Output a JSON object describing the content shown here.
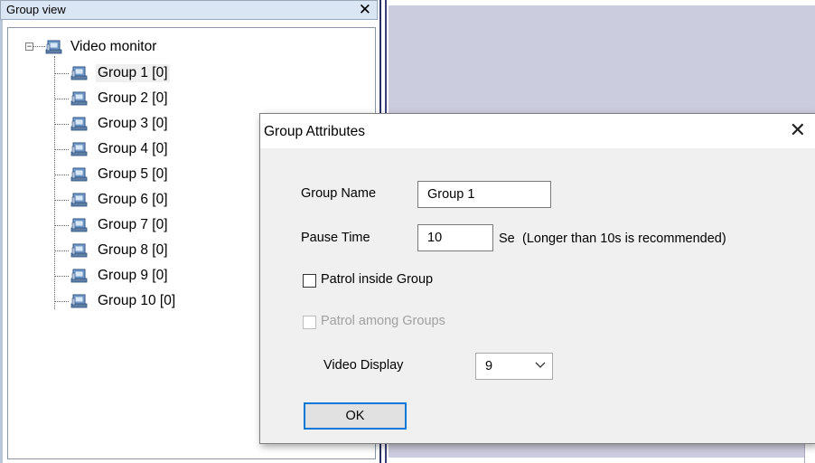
{
  "group_view_panel": {
    "title": "Group view",
    "close_glyph": "✕",
    "tree": {
      "root": {
        "label": "Video monitor",
        "expander": "−",
        "icon": "video-monitor-icon"
      },
      "children": [
        {
          "label": "Group 1 [0]",
          "selected": true,
          "icon": "group-icon"
        },
        {
          "label": "Group 2 [0]",
          "icon": "group-icon"
        },
        {
          "label": "Group 3 [0]",
          "icon": "group-icon"
        },
        {
          "label": "Group 4 [0]",
          "icon": "group-icon"
        },
        {
          "label": "Group 5 [0]",
          "icon": "group-icon"
        },
        {
          "label": "Group 6 [0]",
          "icon": "group-icon"
        },
        {
          "label": "Group 7 [0]",
          "icon": "group-icon"
        },
        {
          "label": "Group 8 [0]",
          "icon": "group-icon"
        },
        {
          "label": "Group 9 [0]",
          "icon": "group-icon"
        },
        {
          "label": "Group 10 [0]",
          "icon": "group-icon"
        }
      ]
    }
  },
  "dialog": {
    "title": "Group Attributes",
    "close_glyph": "✕",
    "group_name_label": "Group Name",
    "group_name_value": "Group 1",
    "pause_time_label": "Pause Time",
    "pause_time_value": "10",
    "pause_time_unit": "Sec",
    "pause_time_hint": "(Longer than 10s is recommended)",
    "patrol_inside_label": "Patrol inside Group",
    "patrol_inside_checked": false,
    "patrol_among_label": "Patrol among Groups",
    "patrol_among_checked": false,
    "patrol_among_enabled": false,
    "video_display_label": "Video Display",
    "video_display_value": "9",
    "ok_label": "OK"
  },
  "colors": {
    "panel_header_bg": "#dbe6f4",
    "right_area_bg": "#ccccdf",
    "splitter": "#2a2f63",
    "dialog_client_bg": "#f0f0f0",
    "focus_blue": "#0078d7"
  }
}
